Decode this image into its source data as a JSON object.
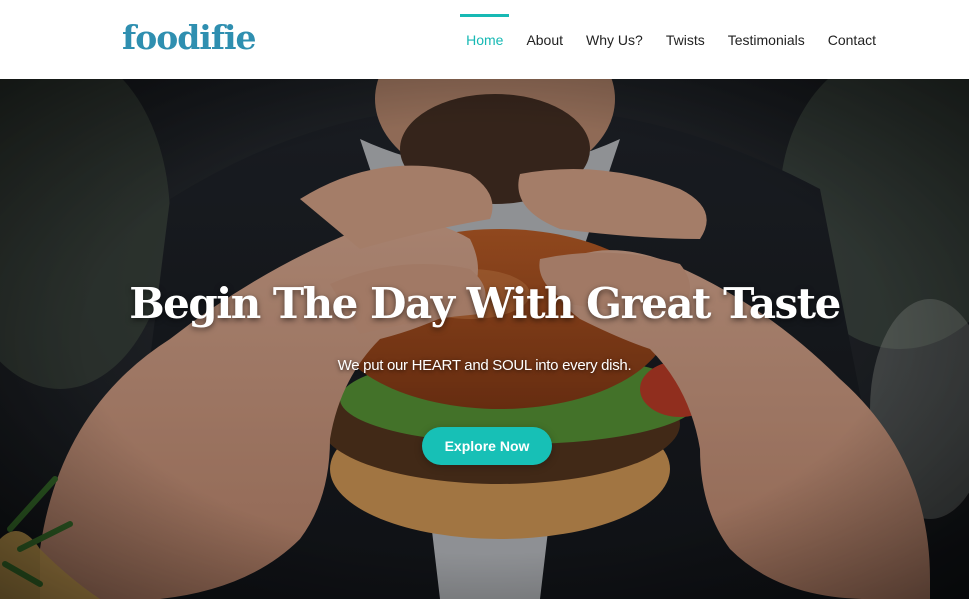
{
  "brand": {
    "logo": "foodifie"
  },
  "nav": {
    "items": [
      {
        "label": "Home",
        "active": true
      },
      {
        "label": "About",
        "active": false
      },
      {
        "label": "Why Us?",
        "active": false
      },
      {
        "label": "Twists",
        "active": false
      },
      {
        "label": "Testimonials",
        "active": false
      },
      {
        "label": "Contact",
        "active": false
      }
    ]
  },
  "hero": {
    "title": "Begin The Day With Great Taste",
    "subtitle": "We put our HEART and SOUL into every dish.",
    "cta_label": "Explore Now",
    "background_image": "photo of a man in a suit holding a burger with both hands"
  },
  "colors": {
    "accent": "#17c0b6",
    "logo": "#2f8fb0",
    "nav_text": "#222222"
  }
}
